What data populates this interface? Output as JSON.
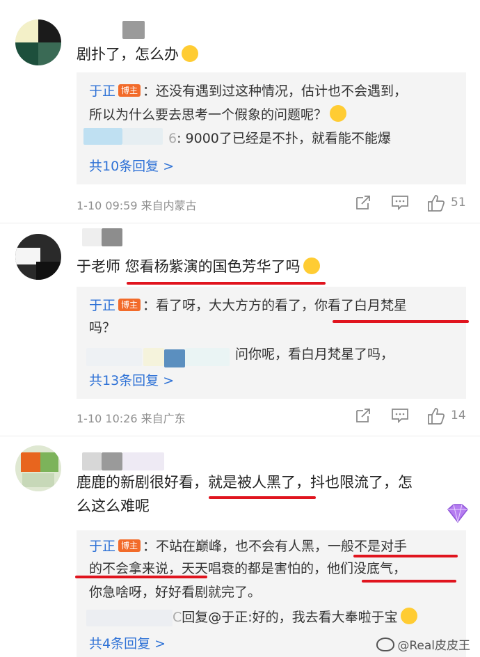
{
  "comments": [
    {
      "text_lines": [
        "剧扑了，怎么办"
      ],
      "emoji": "laughing-crying-emoji",
      "replies": [
        {
          "user": "于正",
          "badge": "博主",
          "lines": [
            "：还没有遇到过这种情况，估计也不会遇到，",
            "所以为什么要去思考一个假象的问题呢？"
          ],
          "emoji": "thinking-emoji"
        },
        {
          "user_visible_fragment": "6",
          "text": ": 9000了已经是不扑，就看能不能爆"
        }
      ],
      "more_replies": "共10条回复 >",
      "time": "1-10 09:59",
      "location": "来自内蒙古",
      "likes": "51"
    },
    {
      "text_lines": [
        "于老师 您看杨紫演的国色芳华了吗"
      ],
      "emoji": "hugging-emoji",
      "replies": [
        {
          "user": "于正",
          "badge": "博主",
          "lines": [
            "：看了呀，大大方方的看了，你看了白月梵星",
            "吗？"
          ]
        },
        {
          "text": "问你呢，看白月梵星了吗，"
        }
      ],
      "more_replies": "共13条回复 >",
      "time": "1-10 10:26",
      "location": "来自广东",
      "likes": "14"
    },
    {
      "text_lines": [
        "鹿鹿的新剧很好看，就是被人黑了，抖也限流了，怎",
        "么这么难呢"
      ],
      "replies": [
        {
          "user": "于正",
          "badge": "博主",
          "lines": [
            "：不站在巅峰，也不会有人黑，一般不是对手",
            "的不会拿来说，天天唱衰的都是害怕的，他们没底气，",
            "你急啥呀，好好看剧就完了。"
          ]
        },
        {
          "user_visible_fragment": "C",
          "text": "回复@于正:好的，我去看大奉啦于宝",
          "emoji": "kiss-emoji"
        }
      ],
      "more_replies": "共4条回复 >"
    }
  ],
  "watermark": "@Real皮皮王",
  "colors": {
    "link": "#2f72d6",
    "badge": "#f26b2a",
    "annotation_red": "#e0141e",
    "reply_bg": "#f4f4f4"
  }
}
